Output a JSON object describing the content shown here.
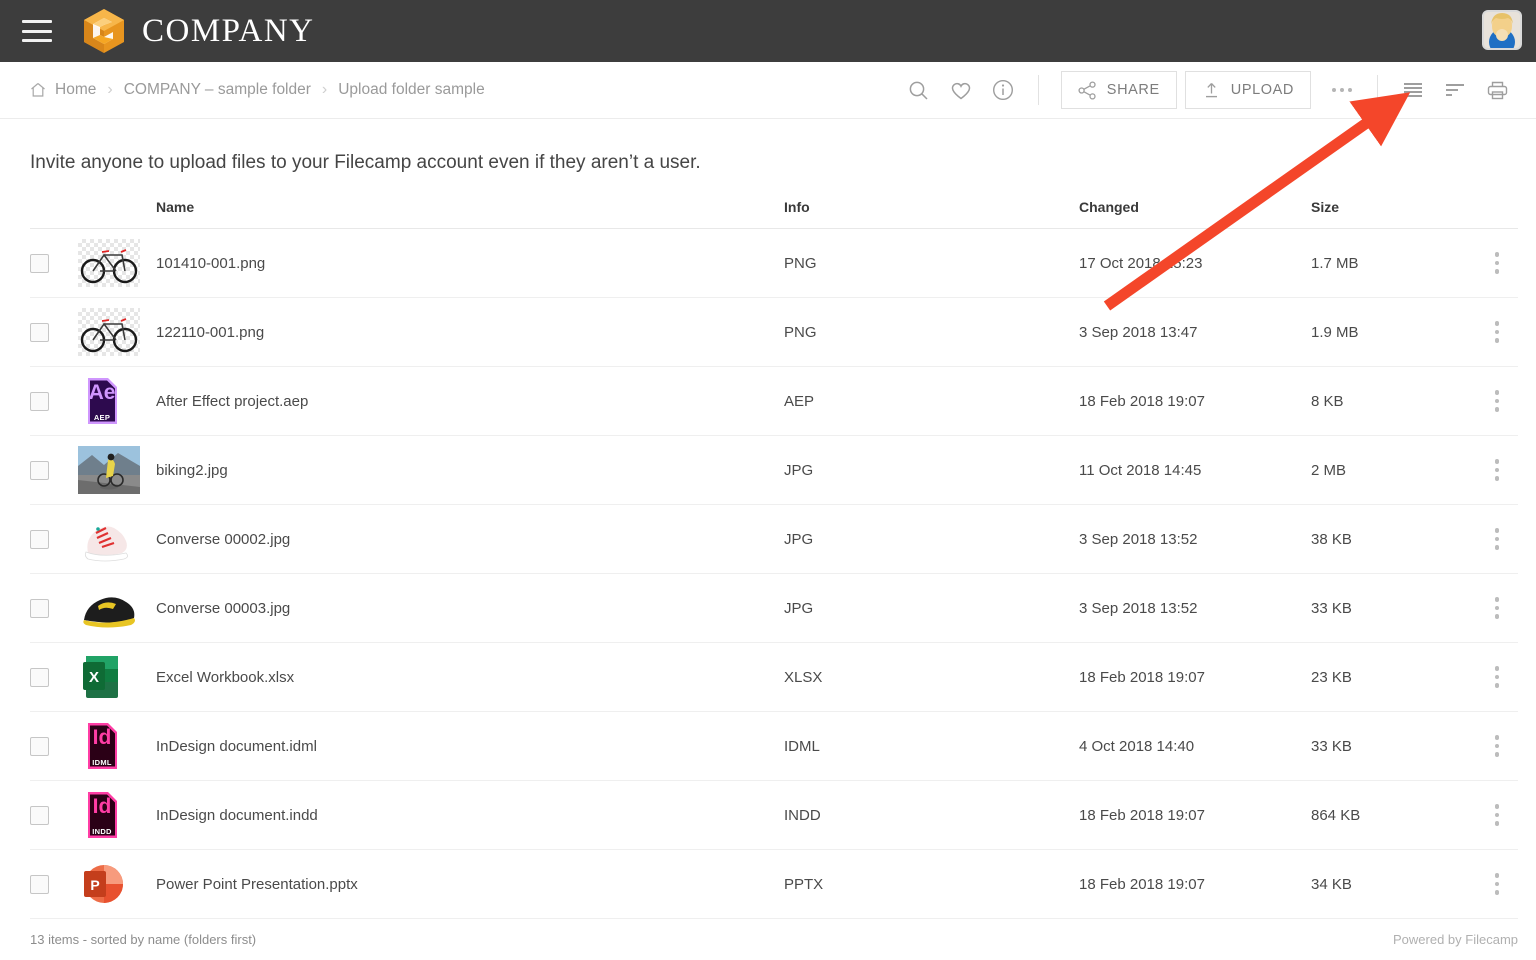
{
  "brand": {
    "name": "COMPANY",
    "logo_icon": "hexagon-c-logo",
    "logo_color": "#f0a02a",
    "bar_color": "#3d3d3d",
    "menu_icon": "hamburger-menu-icon",
    "avatar_icon": "user-avatar-photo"
  },
  "breadcrumb": {
    "home_icon": "home-icon",
    "items": [
      "Home",
      "COMPANY – sample folder",
      "Upload folder sample"
    ],
    "separator": "›"
  },
  "toolbar": {
    "search_icon": "search-icon",
    "favorite_icon": "heart-icon",
    "info_icon": "info-circle-icon",
    "share_label": "SHARE",
    "share_icon": "share-nodes-icon",
    "upload_label": "UPLOAD",
    "upload_icon": "upload-arrow-icon",
    "more_icon": "more-horizontal-icon",
    "list_view_icon": "list-view-icon",
    "sort_icon": "sort-icon",
    "print_icon": "print-icon"
  },
  "intro": "Invite anyone to upload files to your Filecamp account even if they aren’t a user.",
  "table": {
    "columns": [
      "Name",
      "Info",
      "Changed",
      "Size"
    ],
    "rows": [
      {
        "name": "101410-001.png",
        "info": "PNG",
        "changed": "17 Oct 2018 15:23",
        "size": "1.7 MB",
        "thumb": "bicycle-photo",
        "thumb_kind": "image"
      },
      {
        "name": "122110-001.png",
        "info": "PNG",
        "changed": "3 Sep 2018 13:47",
        "size": "1.9 MB",
        "thumb": "bicycle-photo",
        "thumb_kind": "image"
      },
      {
        "name": "After Effect project.aep",
        "info": "AEP",
        "changed": "18 Feb 2018 19:07",
        "size": "8 KB",
        "thumb": "after-effects-file-icon",
        "thumb_kind": "file",
        "badge": "AEP",
        "letter": "Ae",
        "fill": "#2d0a4e",
        "accent": "#cf96fd"
      },
      {
        "name": "biking2.jpg",
        "info": "JPG",
        "changed": "11 Oct 2018 14:45",
        "size": "2 MB",
        "thumb": "cyclist-photo",
        "thumb_kind": "image"
      },
      {
        "name": "Converse 00002.jpg",
        "info": "JPG",
        "changed": "3 Sep 2018 13:52",
        "size": "38 KB",
        "thumb": "red-sneaker-photo",
        "thumb_kind": "image"
      },
      {
        "name": "Converse 00003.jpg",
        "info": "JPG",
        "changed": "3 Sep 2018 13:52",
        "size": "33 KB",
        "thumb": "black-sneaker-photo",
        "thumb_kind": "image"
      },
      {
        "name": "Excel Workbook.xlsx",
        "info": "XLSX",
        "changed": "18 Feb 2018 19:07",
        "size": "23 KB",
        "thumb": "excel-file-icon",
        "thumb_kind": "excel"
      },
      {
        "name": "InDesign document.idml",
        "info": "IDML",
        "changed": "4 Oct 2018 14:40",
        "size": "33 KB",
        "thumb": "indesign-file-icon",
        "thumb_kind": "file",
        "badge": "IDML",
        "letter": "Id",
        "fill": "#2b0016",
        "accent": "#ff3da5"
      },
      {
        "name": "InDesign document.indd",
        "info": "INDD",
        "changed": "18 Feb 2018 19:07",
        "size": "864 KB",
        "thumb": "indesign-file-icon",
        "thumb_kind": "file",
        "badge": "INDD",
        "letter": "Id",
        "fill": "#2b0016",
        "accent": "#ff3da5"
      },
      {
        "name": "Power Point Presentation.pptx",
        "info": "PPTX",
        "changed": "18 Feb 2018 19:07",
        "size": "34 KB",
        "thumb": "powerpoint-file-icon",
        "thumb_kind": "ppt"
      }
    ],
    "row_menu_icon": "more-vertical-icon",
    "checkbox_icon": "checkbox-unchecked"
  },
  "footer": {
    "status": "13 items - sorted by name (folders first)",
    "powered_by": "Powered by Filecamp"
  },
  "annotation": {
    "arrow_color": "#f4462a",
    "points_to": "list-view-icon"
  }
}
